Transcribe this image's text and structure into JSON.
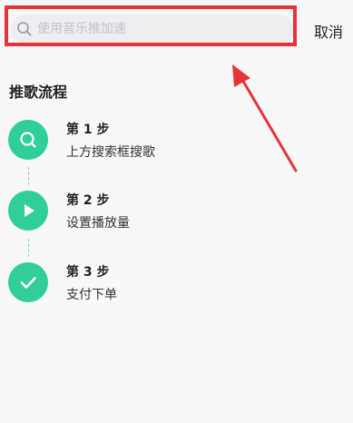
{
  "search": {
    "placeholder": "使用音乐推加速",
    "value": "",
    "cancel_label": "取消"
  },
  "flow": {
    "title": "推歌流程",
    "steps": [
      {
        "title": "第 1 步",
        "desc": "上方搜索框搜歌",
        "icon": "search-icon"
      },
      {
        "title": "第 2 步",
        "desc": "设置播放量",
        "icon": "play-icon"
      },
      {
        "title": "第 3 步",
        "desc": "支付下单",
        "icon": "check-icon"
      }
    ]
  },
  "colors": {
    "accent_green": "#2fce9b",
    "highlight_red": "#e8333a",
    "search_bg": "#eeeef1",
    "page_bg": "#f8f8f9"
  }
}
